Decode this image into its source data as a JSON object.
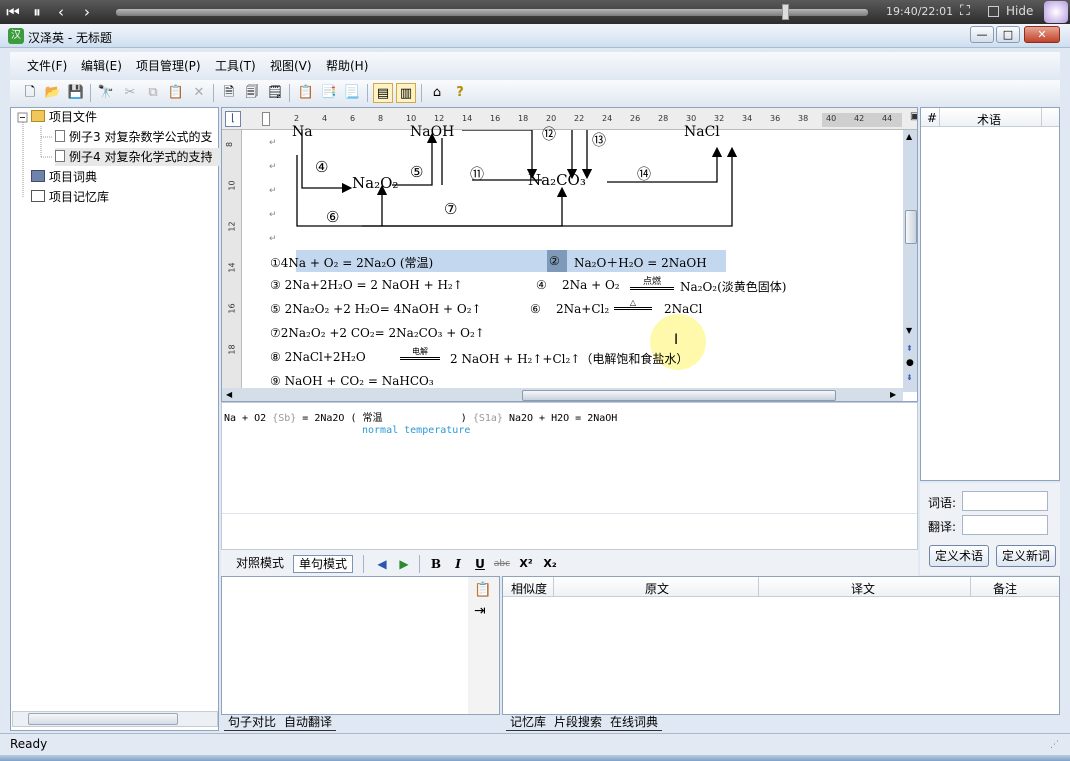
{
  "player": {
    "time": "19:40/22:01",
    "hide_label": "Hide",
    "progress": 0.89
  },
  "window": {
    "title": "汉泽英 - 无标题",
    "app_icon_text": "汉",
    "minimize": "—",
    "maximize": "□",
    "close": "✕"
  },
  "menu": [
    {
      "label": "文件(F)"
    },
    {
      "label": "编辑(E)"
    },
    {
      "label": "项目管理(P)"
    },
    {
      "label": "工具(T)"
    },
    {
      "label": "视图(V)"
    },
    {
      "label": "帮助(H)"
    }
  ],
  "toolbar": [
    {
      "name": "new-icon",
      "glyph": "🗋"
    },
    {
      "name": "open-icon",
      "glyph": "📂"
    },
    {
      "name": "save-icon",
      "glyph": "💾"
    },
    {
      "name": "find-icon",
      "glyph": "🔭"
    },
    {
      "name": "cut-icon",
      "glyph": "✂"
    },
    {
      "name": "copy-icon",
      "glyph": "⧉"
    },
    {
      "name": "paste-icon",
      "glyph": "📋"
    },
    {
      "name": "delete-icon",
      "glyph": "✕"
    },
    {
      "name": "add-doc-icon",
      "glyph": "🗎"
    },
    {
      "name": "save-doc-icon",
      "glyph": "🗐"
    },
    {
      "name": "doc-export-icon",
      "glyph": "🗒"
    },
    {
      "name": "tm-add-icon",
      "glyph": "📋"
    },
    {
      "name": "tm-copy-icon",
      "glyph": "📑"
    },
    {
      "name": "tm-paste-icon",
      "glyph": "📃"
    },
    {
      "name": "view-compare-icon",
      "glyph": "▤"
    },
    {
      "name": "view-single-icon",
      "glyph": "▥"
    },
    {
      "name": "home-icon",
      "glyph": "⌂"
    },
    {
      "name": "help-icon",
      "glyph": "?"
    }
  ],
  "tree": {
    "root": "项目文件",
    "items": [
      "例子3  对复杂数学公式的支",
      "例子4  对复杂化学式的支持"
    ],
    "dict": "项目词典",
    "memory": "项目记忆库"
  },
  "document": {
    "ruler_ticks": [
      "2",
      "4",
      "6",
      "8",
      "10",
      "12",
      "14",
      "16",
      "18",
      "20",
      "22",
      "24",
      "26",
      "28",
      "30",
      "32",
      "34",
      "36",
      "38",
      "40",
      "42",
      "44"
    ],
    "vruler_ticks": [
      "8",
      "10",
      "12",
      "14",
      "16",
      "18"
    ],
    "diagram": {
      "na_top": "Na",
      "naoh_top": "NaOH",
      "nacl_top": "NaCl",
      "c4": "④",
      "c5": "⑤",
      "c11": "⑪",
      "c12": "⑫",
      "c13": "⑬",
      "c14": "⑭",
      "c6": "⑥",
      "c7": "⑦",
      "na2o2": "Na₂O₂",
      "na2co3": "Na₂CO₃"
    },
    "equations": [
      {
        "left": "①4Na   +   O₂  =   2Na₂O  (常温)",
        "right_num": "②",
        "right": "Na₂O＋H₂O   =   2NaOH"
      },
      {
        "left": "③   2Na+2H₂O = 2 NaOH + H₂↑",
        "right_num": "④",
        "right": "2Na + O₂",
        "right_cond": "点燃",
        "right_tail": "Na₂O₂(淡黄色固体)"
      },
      {
        "left": "⑤   2Na₂O₂ +2 H₂O= 4NaOH + O₂↑",
        "right_num": "⑥",
        "right": "2Na+Cl₂",
        "right_cond": "△",
        "right_tail": "2NaCl"
      },
      {
        "left": "⑦2Na₂O₂ +2 CO₂= 2Na₂CO₃ + O₂↑"
      },
      {
        "left": "⑧     2NaCl+2H₂O",
        "cond": "电解",
        "tail": "2 NaOH + H₂↑+Cl₂↑（电解饱和食盐水）"
      },
      {
        "left": "⑨  NaOH + CO₂ = NaHCO₃"
      }
    ]
  },
  "source": {
    "line_a": "Na + O2 ",
    "tag_sb": "{Sb}",
    "line_b": " = 2Na2O ( 常温             ) ",
    "tag_s1a": "{S1a}",
    "line_c": " Na2O + H2O = 2NaOH",
    "translation": "normal temperature"
  },
  "format_bar": {
    "mode_compare": "对照模式",
    "mode_single": "单句模式",
    "prev": "◀",
    "next": "▶",
    "bold": "B",
    "italic": "I",
    "underline": "U",
    "strike": "abc",
    "superscript": "X²",
    "subscript": "X₂"
  },
  "terms": {
    "col_num": "#",
    "col_term": "术语",
    "word_label": "词语:",
    "trans_label": "翻译:",
    "define_term": "定义术语",
    "define_word": "定义新词"
  },
  "tm_table": {
    "columns": [
      "相似度",
      "原文",
      "译文",
      "备注"
    ]
  },
  "bottom_tabs_left": [
    "句子对比",
    "自动翻译"
  ],
  "bottom_tabs_right": [
    "记忆库",
    "片段搜索",
    "在线词典"
  ],
  "status": "Ready"
}
